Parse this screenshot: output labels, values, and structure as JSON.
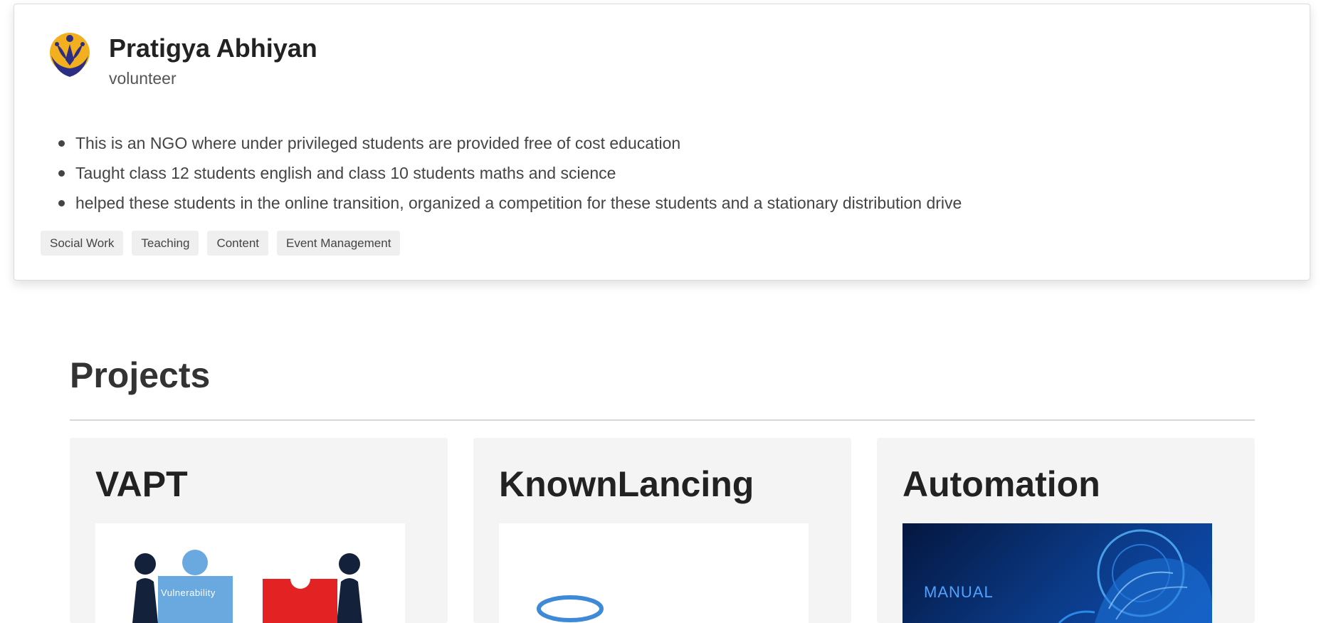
{
  "experience": {
    "organization": "Pratigya Abhiyan",
    "role": "volunteer",
    "bullets": [
      "This is an NGO where under privileged students are provided free of cost education",
      "Taught class 12 students english and class 10 students maths and science",
      "helped these students in the online transition, organized a competition for these students and a stationary distribution drive"
    ],
    "tags": [
      "Social Work",
      "Teaching",
      "Content",
      "Event Management"
    ],
    "logo_icon": "ngo-logo-icon"
  },
  "projects": {
    "heading": "Projects",
    "items": [
      {
        "title": "VAPT",
        "image_text": "Vulnerability",
        "image_icon": "vulnerability-puzzle-image"
      },
      {
        "title": "KnownLancing",
        "image_icon": "knownlancing-logo-image"
      },
      {
        "title": "Automation",
        "image_text": "MANUAL",
        "image_icon": "automation-robot-image"
      }
    ]
  },
  "colors": {
    "card_border": "#dcdcdc",
    "tag_background": "#efefef",
    "project_card_background": "#f4f4f4",
    "logo_yellow": "#f2b01e",
    "logo_navy": "#2b2e83",
    "puzzle_blue": "#6aa9e0",
    "puzzle_red": "#e32224"
  }
}
